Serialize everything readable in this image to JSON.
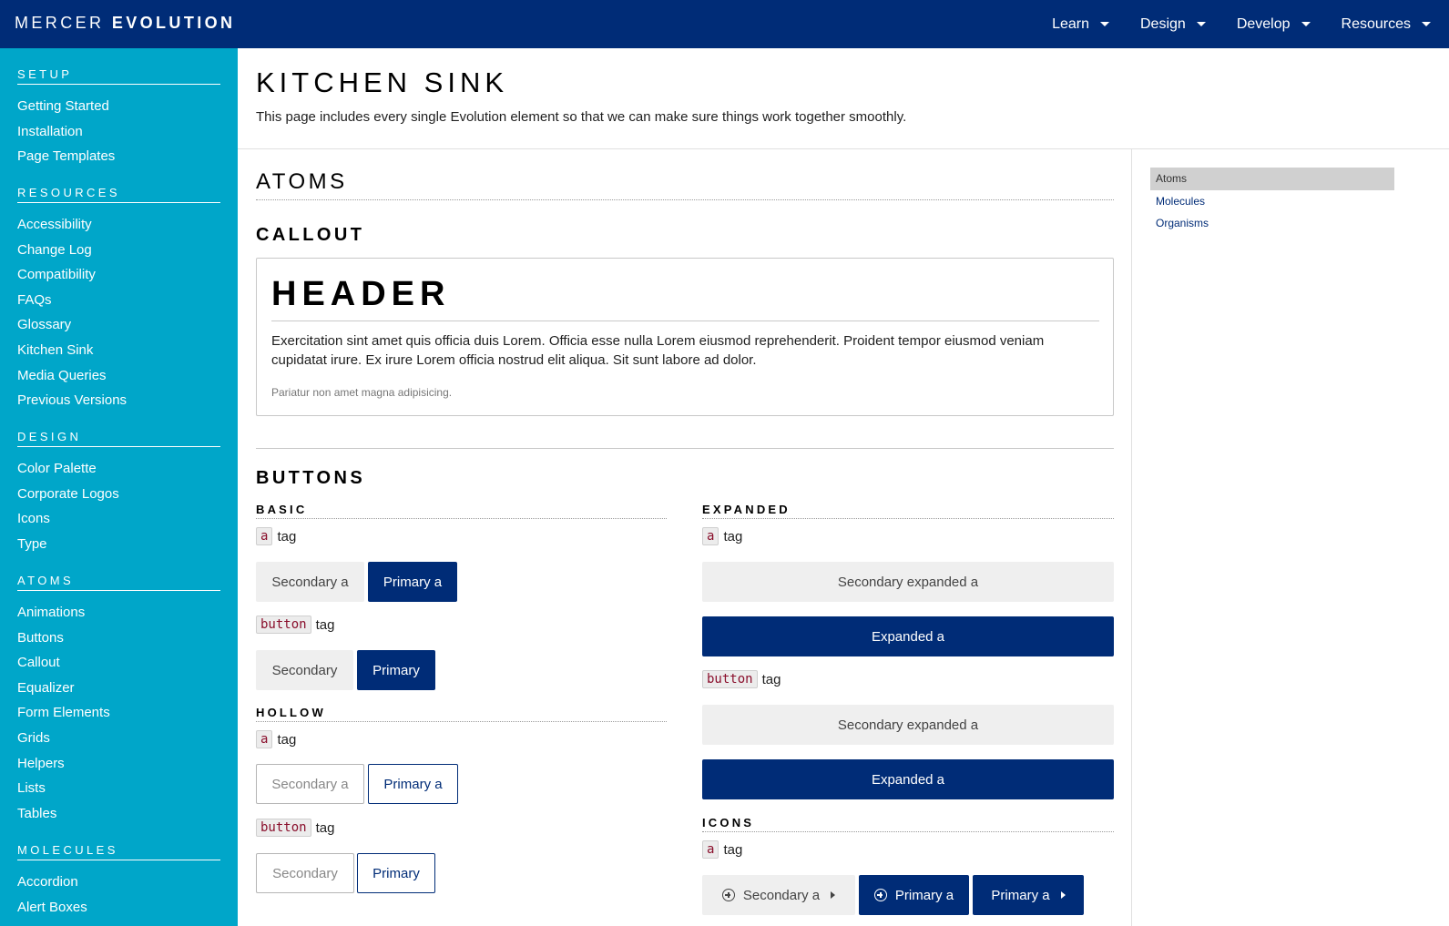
{
  "topbar": {
    "brand_light": "MERCER",
    "brand_bold": "EVOLUTION",
    "nav": [
      "Learn",
      "Design",
      "Develop",
      "Resources"
    ]
  },
  "sidebar": {
    "sections": [
      {
        "heading": "SETUP",
        "items": [
          "Getting Started",
          "Installation",
          "Page Templates"
        ]
      },
      {
        "heading": "RESOURCES",
        "items": [
          "Accessibility",
          "Change Log",
          "Compatibility",
          "FAQs",
          "Glossary",
          "Kitchen Sink",
          "Media Queries",
          "Previous Versions"
        ]
      },
      {
        "heading": "DESIGN",
        "items": [
          "Color Palette",
          "Corporate Logos",
          "Icons",
          "Type"
        ]
      },
      {
        "heading": "ATOMS",
        "items": [
          "Animations",
          "Buttons",
          "Callout",
          "Equalizer",
          "Form Elements",
          "Grids",
          "Helpers",
          "Lists",
          "Tables"
        ]
      },
      {
        "heading": "MOLECULES",
        "items": [
          "Accordion",
          "Alert Boxes"
        ]
      }
    ]
  },
  "page": {
    "title": "KITCHEN SINK",
    "description": "This page includes every single Evolution element so that we can make sure things work together smoothly."
  },
  "toc": {
    "items": [
      "Atoms",
      "Molecules",
      "Organisms"
    ],
    "active": "Atoms"
  },
  "atoms": {
    "title": "ATOMS",
    "callout": {
      "title": "CALLOUT",
      "header": "HEADER",
      "body": "Exercitation sint amet quis officia duis Lorem. Officia esse nulla Lorem eiusmod reprehenderit. Proident tempor eiusmod veniam cupidatat irure. Ex irure Lorem officia nostrud elit aliqua. Sit sunt labore ad dolor.",
      "footnote": "Pariatur non amet magna adipisicing."
    },
    "buttons": {
      "title": "BUTTONS",
      "tag_word": "tag",
      "code_a": "a",
      "code_button": "button",
      "basic": {
        "heading": "BASIC",
        "secondary_a": "Secondary a",
        "primary_a": "Primary a",
        "secondary": "Secondary",
        "primary": "Primary"
      },
      "hollow": {
        "heading": "HOLLOW",
        "secondary_a": "Secondary a",
        "primary_a": "Primary a",
        "secondary": "Secondary",
        "primary": "Primary"
      },
      "expanded": {
        "heading": "EXPANDED",
        "secondary_a": "Secondary expanded a",
        "primary_a": "Expanded a",
        "secondary": "Secondary expanded a",
        "primary": "Expanded a"
      },
      "icons": {
        "heading": "ICONS",
        "secondary_a": "Secondary a",
        "primary_a": "Primary a",
        "primary_a_right": "Primary a"
      }
    }
  },
  "colors": {
    "navy": "#002c77",
    "teal": "#00a6c9",
    "light_gray": "#efefef"
  }
}
